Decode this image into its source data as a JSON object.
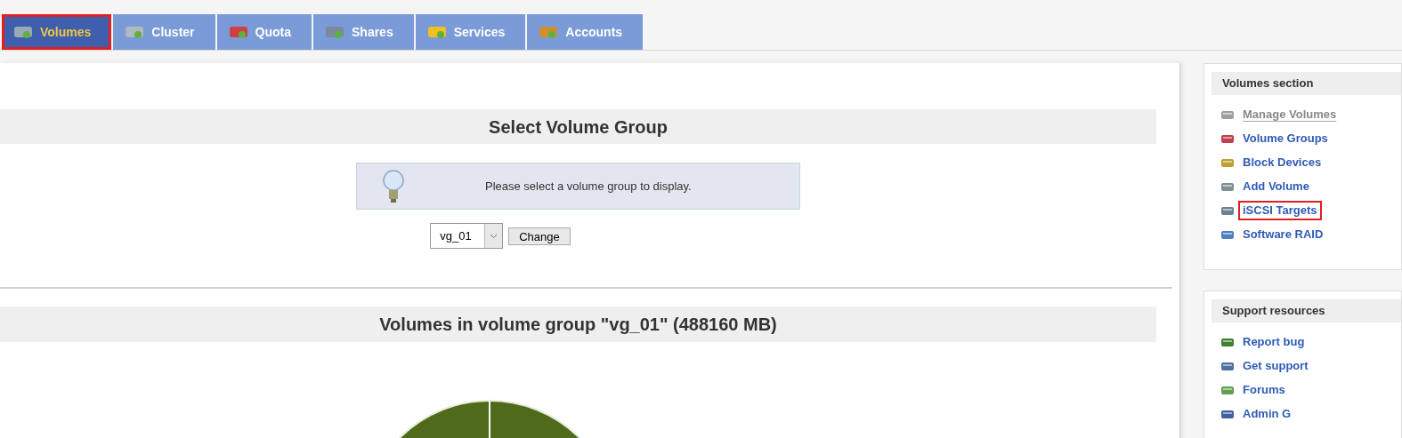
{
  "tabs": [
    {
      "label": "Volumes",
      "selected": true,
      "highlighted": true
    },
    {
      "label": "Cluster",
      "selected": false,
      "highlighted": false
    },
    {
      "label": "Quota",
      "selected": false,
      "highlighted": false
    },
    {
      "label": "Shares",
      "selected": false,
      "highlighted": false
    },
    {
      "label": "Services",
      "selected": false,
      "highlighted": false
    },
    {
      "label": "Accounts",
      "selected": false,
      "highlighted": false
    }
  ],
  "main": {
    "select_section": {
      "title": "Select Volume Group",
      "info": "Please select a volume group to display.",
      "dropdown": {
        "value": "vg_01"
      },
      "button": "Change"
    },
    "volumes_section": {
      "title": "Volumes in volume group \"vg_01\" (488160 MB)"
    }
  },
  "sidebar": [
    {
      "title": "Volumes section",
      "links": [
        {
          "label": "Manage Volumes",
          "current": true,
          "highlighted": false
        },
        {
          "label": "Volume Groups",
          "current": false,
          "highlighted": false
        },
        {
          "label": "Block Devices",
          "current": false,
          "highlighted": false
        },
        {
          "label": "Add Volume",
          "current": false,
          "highlighted": false
        },
        {
          "label": "iSCSI Targets",
          "current": false,
          "highlighted": true
        },
        {
          "label": "Software RAID",
          "current": false,
          "highlighted": false
        }
      ]
    },
    {
      "title": "Support resources",
      "links": [
        {
          "label": "Report bug",
          "current": false,
          "highlighted": false
        },
        {
          "label": "Get support",
          "current": false,
          "highlighted": false
        },
        {
          "label": "Forums",
          "current": false,
          "highlighted": false
        },
        {
          "label": "Admin G",
          "current": false,
          "highlighted": false
        }
      ]
    }
  ]
}
